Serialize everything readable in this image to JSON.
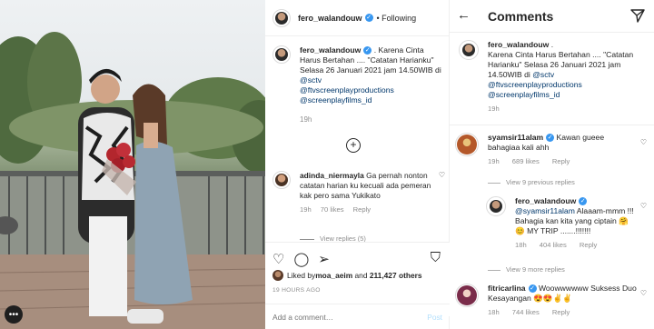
{
  "post": {
    "username": "fero_walandouw",
    "following_label": "• Following",
    "caption_user": "fero_walandouw",
    "caption_dot": " .",
    "caption_text": "Karena Cinta Harus Bertahan .... \"Catatan Harianku\" Selasa 26 Januari 2021 jam 14.50WIB di ",
    "caption_mention1": "@sctv",
    "caption_mention2": "@ftvscreenplayproductions",
    "caption_mention3": "@screenplayfilms_id",
    "caption_time": "19h",
    "comment": {
      "user": "adinda_niermayla",
      "text": " Ga pernah nonton catatan harian ku kecuali ada pemeran kak pero sama Yukikato",
      "time": "19h",
      "likes": "70 likes",
      "reply": "Reply",
      "view_replies": "View replies (5)"
    },
    "liked_by_prefix": "Liked by ",
    "liked_by_user": "moa_aeim",
    "liked_by_and": " and ",
    "liked_by_count": "211,427 others",
    "posted_ago": "19 HOURS AGO",
    "add_comment_placeholder": "Add a comment…",
    "post_button": "Post"
  },
  "comments_panel": {
    "title": "Comments",
    "caption": {
      "user": "fero_walandouw",
      "dot": " .",
      "text": "Karena Cinta Harus Bertahan .... \"Catatan Harianku\" Selasa 26 Januari 2021 jam 14.50WIB di ",
      "m1": "@sctv",
      "m2": "@ftvscreenplayproductions",
      "m3": "@screenplayfilms_id",
      "time": "19h"
    },
    "c1": {
      "user": "syamsir11alam",
      "text": " Kawan gueee bahagiaa kali ahh",
      "time": "19h",
      "likes": "689 likes",
      "reply": "Reply",
      "view": "View 9 previous replies"
    },
    "c2": {
      "user": "fero_walandouw",
      "mention": "@syamsir11alam",
      "text": " Alaaam-mmm !!! Bahagia kan kita yang ciptain 🤗😊 MY TRIP .......!!!!!!!",
      "time": "18h",
      "likes": "404 likes",
      "reply": "Reply",
      "view": "View 9 more replies"
    },
    "c3": {
      "user": "fitricarlina",
      "text": " Woowwwwww Suksess Duo Kesayangan 😍😍✌✌",
      "time": "18h",
      "likes": "744 likes",
      "reply": "Reply"
    }
  }
}
